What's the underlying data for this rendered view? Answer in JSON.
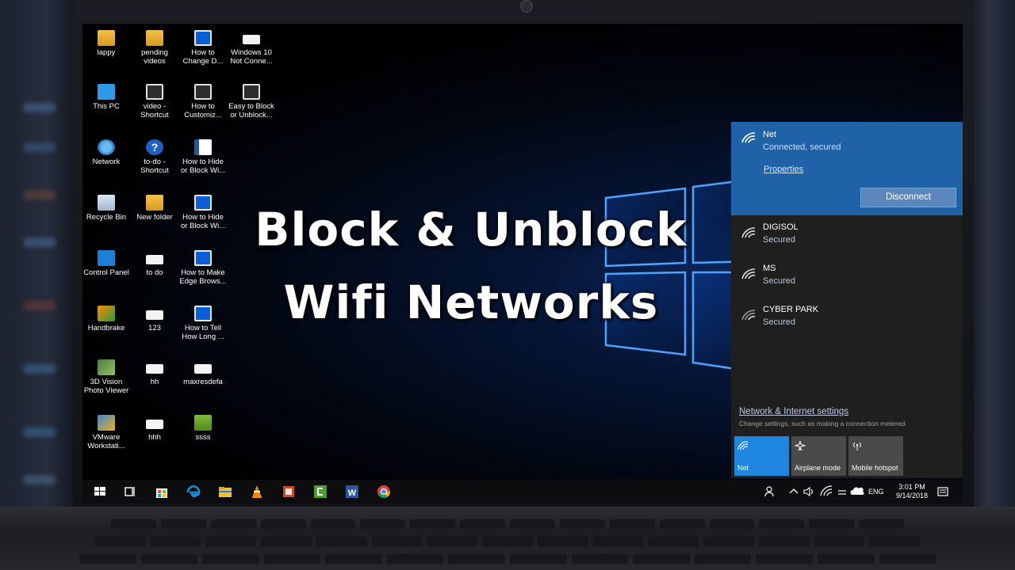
{
  "overlay": {
    "line1": "Block & Unblock",
    "line2": "Wifi Networks"
  },
  "desktop": {
    "icons": [
      {
        "label": "lappy",
        "icon": "user-folder-icon"
      },
      {
        "label": "This PC",
        "icon": "pc-icon"
      },
      {
        "label": "Network",
        "icon": "network-icon"
      },
      {
        "label": "Recycle Bin",
        "icon": "recycle-bin-icon"
      },
      {
        "label": "Control Panel",
        "icon": "control-panel-icon"
      },
      {
        "label": "Handbrake",
        "icon": "handbrake-icon"
      },
      {
        "label": "3D Vision Photo Viewer",
        "icon": "photo-viewer-icon"
      },
      {
        "label": "VMware Workstati...",
        "icon": "vmware-icon"
      },
      {
        "label": "pending videos",
        "icon": "folder-icon"
      },
      {
        "label": "video - Shortcut",
        "icon": "shortcut-icon"
      },
      {
        "label": "to-do - Shortcut",
        "icon": "help-icon"
      },
      {
        "label": "New folder",
        "icon": "folder-icon"
      },
      {
        "label": "to do",
        "icon": "file-icon"
      },
      {
        "label": "123",
        "icon": "file-icon"
      },
      {
        "label": "hh",
        "icon": "file-icon"
      },
      {
        "label": "hhh",
        "icon": "file-icon"
      },
      {
        "label": "How to Change D...",
        "icon": "video-icon"
      },
      {
        "label": "How to Customiz...",
        "icon": "video-icon"
      },
      {
        "label": "How to Hide or Block Wi...",
        "icon": "word-doc-icon"
      },
      {
        "label": "How to Hide or Block Wi...",
        "icon": "video-icon"
      },
      {
        "label": "How to Make Edge Brows...",
        "icon": "video-icon"
      },
      {
        "label": "How to Tell How Long ...",
        "icon": "video-icon"
      },
      {
        "label": "maxresdefa",
        "icon": "image-icon"
      },
      {
        "label": "ssss",
        "icon": "image-icon"
      },
      {
        "label": "Windows 10 Not Conne...",
        "icon": "video-icon"
      },
      {
        "label": "Easy to Block or Unblock...",
        "icon": "video-icon"
      }
    ]
  },
  "network_flyout": {
    "connected": {
      "name": "Net",
      "status": "Connected, secured",
      "properties_label": "Properties",
      "disconnect_label": "Disconnect"
    },
    "networks": [
      {
        "name": "DIGISOL",
        "status": "Secured"
      },
      {
        "name": "MS",
        "status": "Secured"
      },
      {
        "name": "CYBER PARK",
        "status": "Secured"
      }
    ],
    "settings_link": "Network & Internet settings",
    "settings_sub": "Change settings, such as making a connection metered.",
    "tiles": [
      {
        "label": "Net",
        "active": true,
        "icon": "wifi-icon"
      },
      {
        "label": "Airplane mode",
        "active": false,
        "icon": "airplane-icon"
      },
      {
        "label": "Mobile hotspot",
        "active": false,
        "icon": "hotspot-icon"
      }
    ]
  },
  "taskbar": {
    "apps": [
      "start-icon",
      "task-view-icon",
      "store-icon",
      "edge-icon",
      "file-explorer-icon",
      "vlc-icon",
      "powerpoint-icon",
      "camtasia-icon",
      "word-icon",
      "chrome-icon"
    ],
    "language": "ENG",
    "time": "3:01 PM",
    "date": "9/14/2018"
  },
  "colors": {
    "accent": "#1f62a8",
    "tile_active": "#1f86e0",
    "taskbar": "#0d0d0f"
  }
}
